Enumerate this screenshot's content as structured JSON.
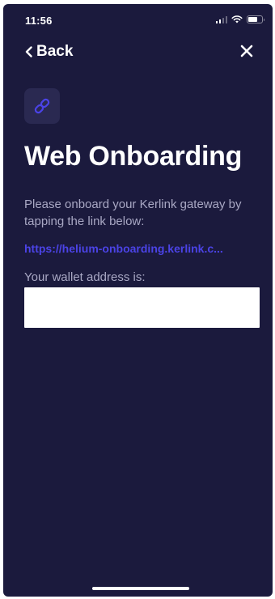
{
  "status_bar": {
    "time": "11:56"
  },
  "nav": {
    "back_label": "Back"
  },
  "content": {
    "title": "Web Onboarding",
    "instructions": "Please onboard your Kerlink gateway by tapping the link below:",
    "link_text": "https://helium-onboarding.kerlink.c...",
    "wallet_label": "Your wallet address is:",
    "wallet_value": ""
  },
  "colors": {
    "background": "#1b1a3d",
    "link_accent": "#4b43e6",
    "muted_text": "#a9a8c4"
  },
  "icons": {
    "back": "chevron-left-icon",
    "close": "close-icon",
    "link": "link-icon"
  }
}
